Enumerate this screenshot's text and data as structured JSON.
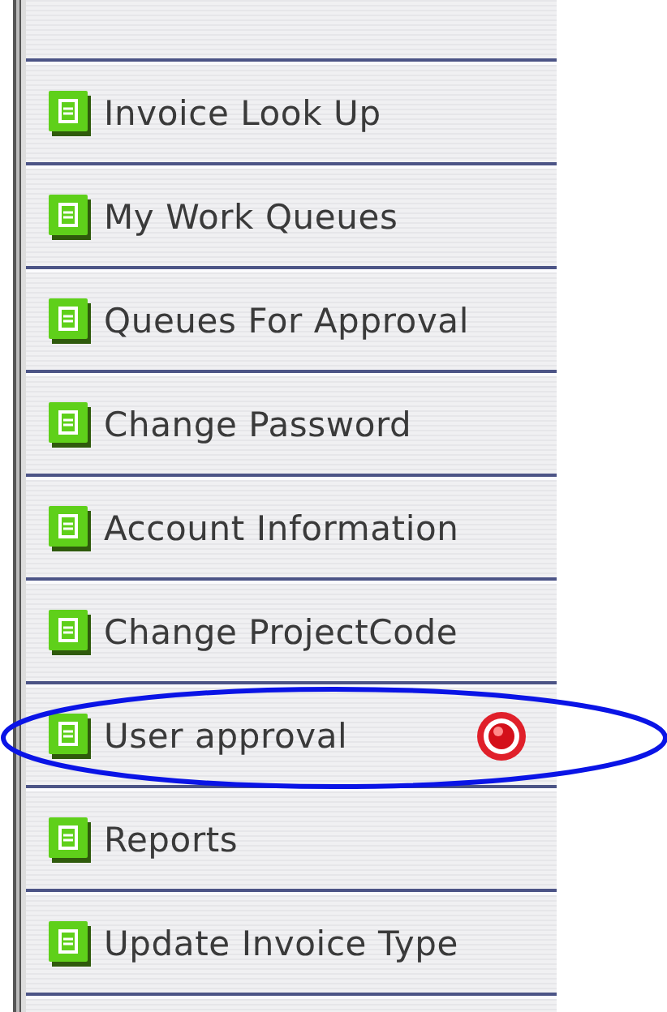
{
  "menu": {
    "items": [
      {
        "label": "Invoice Look Up",
        "alert": false,
        "circled": false
      },
      {
        "label": "My Work Queues",
        "alert": false,
        "circled": false
      },
      {
        "label": "Queues For Approval",
        "alert": false,
        "circled": false
      },
      {
        "label": "Change Password",
        "alert": false,
        "circled": false
      },
      {
        "label": "Account Information",
        "alert": false,
        "circled": false
      },
      {
        "label": "Change ProjectCode",
        "alert": false,
        "circled": false
      },
      {
        "label": "User approval",
        "alert": true,
        "circled": true
      },
      {
        "label": "Reports",
        "alert": false,
        "circled": false
      },
      {
        "label": "Update Invoice Type",
        "alert": false,
        "circled": false
      }
    ]
  }
}
